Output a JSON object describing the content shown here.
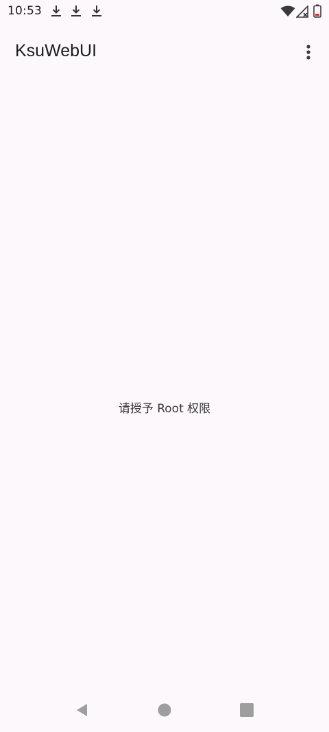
{
  "status_bar": {
    "time": "10:53",
    "icons": [
      "download-icon",
      "download-icon",
      "download-icon",
      "wifi-icon",
      "signal-no-data-icon",
      "battery-icon"
    ]
  },
  "app_bar": {
    "title": "KsuWebUI",
    "menu_icon": "more-vert-icon"
  },
  "main": {
    "message": "请授予 Root 权限"
  },
  "nav_bar": {
    "icons": [
      "back-icon",
      "home-icon",
      "recents-icon"
    ]
  },
  "colors": {
    "background": "#fdf8fc",
    "text": "#1c1b1f",
    "nav": "#9e9e9e"
  }
}
